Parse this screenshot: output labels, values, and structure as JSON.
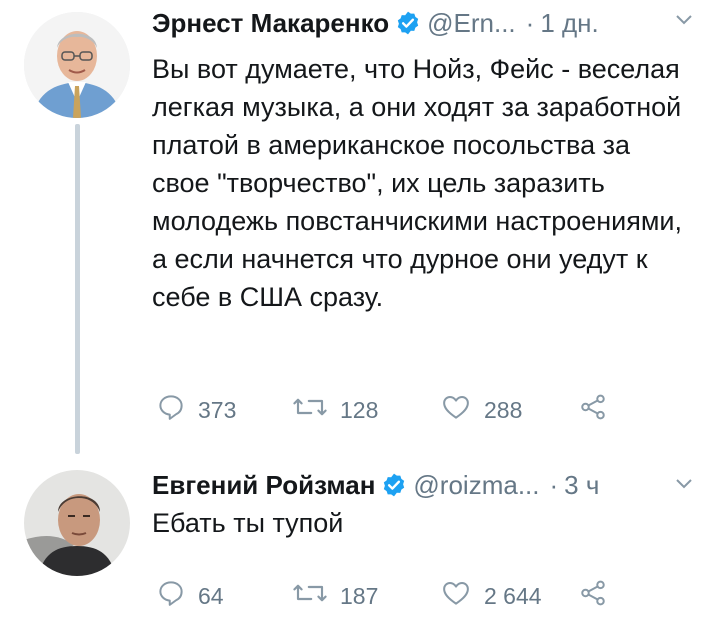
{
  "tweets": [
    {
      "author_name": "Эрнест Макаренко",
      "handle": "@Ern...",
      "separator": "·",
      "time": "1 дн.",
      "text": "Вы вот думаете, что Нойз, Фейс - веселая легкая музыка, а они ходят за заработной платой в американское посольства за свое \"творчество\", их цель заразить молодежь повстанчискими настроениями, а если начнется что дурное они уедут к себе в США сразу.",
      "replies": "373",
      "retweets": "128",
      "likes": "288"
    },
    {
      "author_name": "Евгений Ройзман",
      "handle": "@roizma...",
      "separator": "·",
      "time": "3 ч",
      "text": "Ебать ты тупой",
      "replies": "64",
      "retweets": "187",
      "likes": "2 644"
    }
  ],
  "icons": {
    "verified": "verified-badge-icon",
    "chevron": "chevron-down-icon",
    "reply": "reply-icon",
    "retweet": "retweet-icon",
    "like": "heart-icon",
    "share": "share-icon"
  },
  "colors": {
    "verified": "#1da1f2",
    "secondary_text": "#657786",
    "primary_text": "#14171a",
    "thread_line": "#c9d3db"
  }
}
